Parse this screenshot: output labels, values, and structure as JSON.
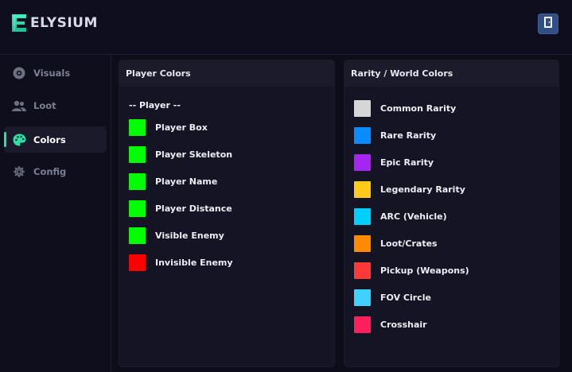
{
  "app": {
    "brand": "ELYSIUM",
    "accent": "#2ee0a8"
  },
  "header": {
    "exit_icon": "exit-door-icon"
  },
  "sidebar": {
    "items": [
      {
        "label": "Visuals",
        "icon": "eye-icon",
        "active": false
      },
      {
        "label": "Loot",
        "icon": "users-icon",
        "active": false
      },
      {
        "label": "Colors",
        "icon": "palette-icon",
        "active": true
      },
      {
        "label": "Config",
        "icon": "gear-icon",
        "active": false
      }
    ]
  },
  "player_panel": {
    "title": "Player Colors",
    "group": "-- Player --",
    "items": [
      {
        "label": "Player Box",
        "color": "#00ff00"
      },
      {
        "label": "Player Skeleton",
        "color": "#00ff00"
      },
      {
        "label": "Player Name",
        "color": "#00ff00"
      },
      {
        "label": "Player Distance",
        "color": "#00ff00"
      },
      {
        "label": "Visible Enemy",
        "color": "#00ff00"
      },
      {
        "label": "Invisible Enemy",
        "color": "#ff0000"
      }
    ]
  },
  "world_panel": {
    "title": "Rarity / World Colors",
    "items": [
      {
        "label": "Common Rarity",
        "color": "#d6d6d6"
      },
      {
        "label": "Rare Rarity",
        "color": "#0a8cff"
      },
      {
        "label": "Epic Rarity",
        "color": "#a625f2"
      },
      {
        "label": "Legendary Rarity",
        "color": "#ffca1c"
      },
      {
        "label": "ARC (Vehicle)",
        "color": "#00cfff"
      },
      {
        "label": "Loot/Crates",
        "color": "#ff8a00"
      },
      {
        "label": "Pickup (Weapons)",
        "color": "#ff3838"
      },
      {
        "label": "FOV Circle",
        "color": "#3fd2ff"
      },
      {
        "label": "Crosshair",
        "color": "#ff1f5c"
      }
    ]
  }
}
